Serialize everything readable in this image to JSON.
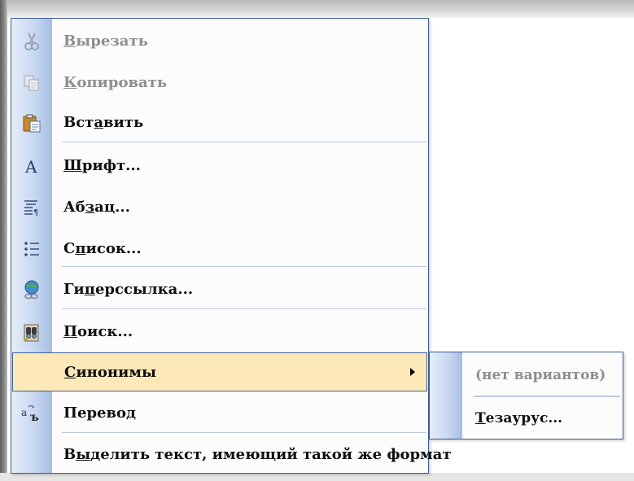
{
  "menu": {
    "items": [
      {
        "id": "cut",
        "pre": "",
        "ul": "В",
        "post": "ырезать",
        "disabled": true,
        "icon": "scissors-icon"
      },
      {
        "id": "copy",
        "pre": "",
        "ul": "К",
        "post": "опировать",
        "disabled": true,
        "icon": "copy-icon"
      },
      {
        "id": "paste",
        "pre": "Вст",
        "ul": "а",
        "post": "вить",
        "disabled": false,
        "icon": "paste-icon"
      },
      {
        "id": "font",
        "pre": "",
        "ul": "Ш",
        "post": "рифт...",
        "disabled": false,
        "icon": "font-icon"
      },
      {
        "id": "paragraph",
        "pre": "Аб",
        "ul": "з",
        "post": "ац...",
        "disabled": false,
        "icon": "paragraph-icon"
      },
      {
        "id": "list",
        "pre": "С",
        "ul": "п",
        "post": "исок...",
        "disabled": false,
        "icon": "bullet-list-icon"
      },
      {
        "id": "hyperlink",
        "pre": "Ги",
        "ul": "п",
        "post": "ерссылка...",
        "disabled": false,
        "icon": "hyperlink-icon"
      },
      {
        "id": "search",
        "pre": "",
        "ul": "П",
        "post": "оиск...",
        "disabled": false,
        "icon": "search-binoculars-icon"
      },
      {
        "id": "synonyms",
        "pre": "",
        "ul": "С",
        "post": "инонимы",
        "disabled": false,
        "icon": "",
        "submenu": true
      },
      {
        "id": "translate",
        "pre": "Перево",
        "ul": "д",
        "post": "",
        "disabled": false,
        "icon": "translate-icon"
      },
      {
        "id": "select-format",
        "pre": "В",
        "ul": "ы",
        "post": "делить текст, имеющий такой же формат",
        "disabled": false,
        "icon": ""
      }
    ]
  },
  "submenu": {
    "items": [
      {
        "id": "no-options",
        "pre": "(нет вариантов)",
        "ul": "",
        "post": "",
        "disabled": true
      },
      {
        "id": "thesaurus",
        "pre": "",
        "ul": "Т",
        "post": "езаурус...",
        "disabled": false
      }
    ]
  },
  "colors": {
    "highlight": "#fde8b8",
    "border": "#3e5e93",
    "disabled_text": "#8e8e8e"
  }
}
